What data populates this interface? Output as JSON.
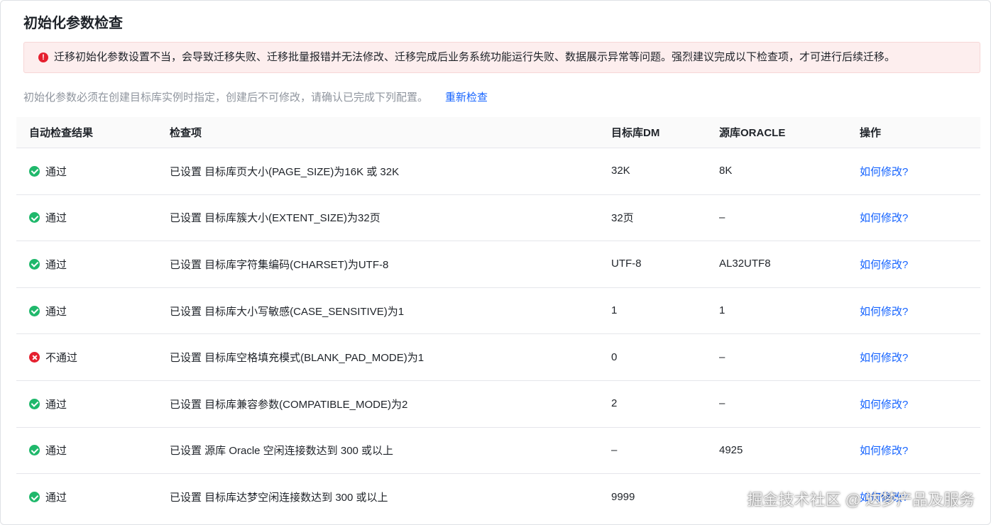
{
  "page_title": "初始化参数检查",
  "alert": {
    "icon": "exclamation-icon",
    "text": "迁移初始化参数设置不当，会导致迁移失败、迁移批量报错并无法修改、迁移完成后业务系统功能运行失败、数据展示异常等问题。强烈建议完成以下检查项，才可进行后续迁移。",
    "color": "#e5202f"
  },
  "hint": {
    "text": "初始化参数必须在创建目标库实例时指定，创建后不可修改，请确认已完成下列配置。",
    "recheck_label": "重新检查"
  },
  "table": {
    "headers": [
      "自动检查结果",
      "检查项",
      "目标库DM",
      "源库ORACLE",
      "操作"
    ],
    "rows": [
      {
        "status": "pass",
        "status_label": "通过",
        "item": "已设置 目标库页大小(PAGE_SIZE)为16K 或 32K",
        "target": "32K",
        "source": "8K",
        "action": "如何修改?"
      },
      {
        "status": "pass",
        "status_label": "通过",
        "item": "已设置 目标库簇大小(EXTENT_SIZE)为32页",
        "target": "32页",
        "source": "–",
        "action": "如何修改?"
      },
      {
        "status": "pass",
        "status_label": "通过",
        "item": "已设置 目标库字符集编码(CHARSET)为UTF-8",
        "target": "UTF-8",
        "source": "AL32UTF8",
        "action": "如何修改?"
      },
      {
        "status": "pass",
        "status_label": "通过",
        "item": "已设置 目标库大小写敏感(CASE_SENSITIVE)为1",
        "target": "1",
        "source": "1",
        "action": "如何修改?"
      },
      {
        "status": "fail",
        "status_label": "不通过",
        "item": "已设置 目标库空格填充模式(BLANK_PAD_MODE)为1",
        "target": "0",
        "source": "–",
        "action": "如何修改?"
      },
      {
        "status": "pass",
        "status_label": "通过",
        "item": "已设置 目标库兼容参数(COMPATIBLE_MODE)为2",
        "target": "2",
        "source": "–",
        "action": "如何修改?"
      },
      {
        "status": "pass",
        "status_label": "通过",
        "item": "已设置 源库 Oracle 空闲连接数达到 300 或以上",
        "target": "–",
        "source": "4925",
        "action": "如何修改?"
      },
      {
        "status": "pass",
        "status_label": "通过",
        "item": "已设置 目标库达梦空闲连接数达到 300 或以上",
        "target": "9999",
        "source": "",
        "action": "如何修改?"
      }
    ]
  },
  "watermark": "掘金技术社区 @ 达梦产品及服务",
  "colors": {
    "pass": "#1fb86b",
    "fail": "#e5202f",
    "link": "#1664ff",
    "alert_bg": "#fdeeee"
  }
}
